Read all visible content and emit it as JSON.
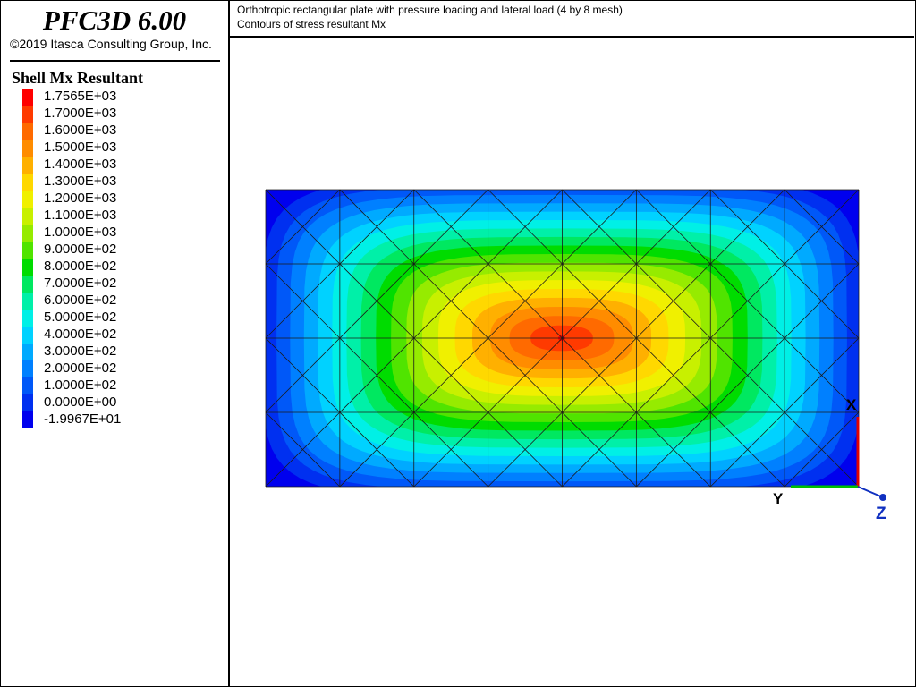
{
  "app": {
    "title": "PFC3D 6.00",
    "copyright": "©2019 Itasca Consulting Group, Inc."
  },
  "legend": {
    "title": "Shell Mx Resultant",
    "entries": [
      {
        "label": "1.7565E+03",
        "color": "#ff0000"
      },
      {
        "label": "1.7000E+03",
        "color": "#ff3a00"
      },
      {
        "label": "1.6000E+03",
        "color": "#ff6a00"
      },
      {
        "label": "1.5000E+03",
        "color": "#ff8c00"
      },
      {
        "label": "1.4000E+03",
        "color": "#ffb000"
      },
      {
        "label": "1.3000E+03",
        "color": "#ffd800"
      },
      {
        "label": "1.2000E+03",
        "color": "#f0f000"
      },
      {
        "label": "1.1000E+03",
        "color": "#c8f000"
      },
      {
        "label": "1.0000E+03",
        "color": "#96eb00"
      },
      {
        "label": "9.0000E+02",
        "color": "#50e400"
      },
      {
        "label": "8.0000E+02",
        "color": "#00dc00"
      },
      {
        "label": "7.0000E+02",
        "color": "#00e860"
      },
      {
        "label": "6.0000E+02",
        "color": "#00f0a8"
      },
      {
        "label": "5.0000E+02",
        "color": "#00f0e6"
      },
      {
        "label": "4.0000E+02",
        "color": "#00d2ff"
      },
      {
        "label": "3.0000E+02",
        "color": "#00aaff"
      },
      {
        "label": "2.0000E+02",
        "color": "#0080ff"
      },
      {
        "label": "1.0000E+02",
        "color": "#0058f8"
      },
      {
        "label": "0.0000E+00",
        "color": "#0030f0"
      },
      {
        "label": "-1.9967E+01",
        "color": "#0000ee"
      }
    ]
  },
  "header": {
    "line1": "Orthotropic rectangular plate with pressure loading and lateral load (4 by 8 mesh)",
    "line2": "Contours of stress resultant Mx"
  },
  "axes": {
    "x_label": "X",
    "y_label": "Y",
    "z_label": "Z",
    "x_color": "#e00000",
    "y_color": "#00c000",
    "z_color": "#1030c0"
  }
}
